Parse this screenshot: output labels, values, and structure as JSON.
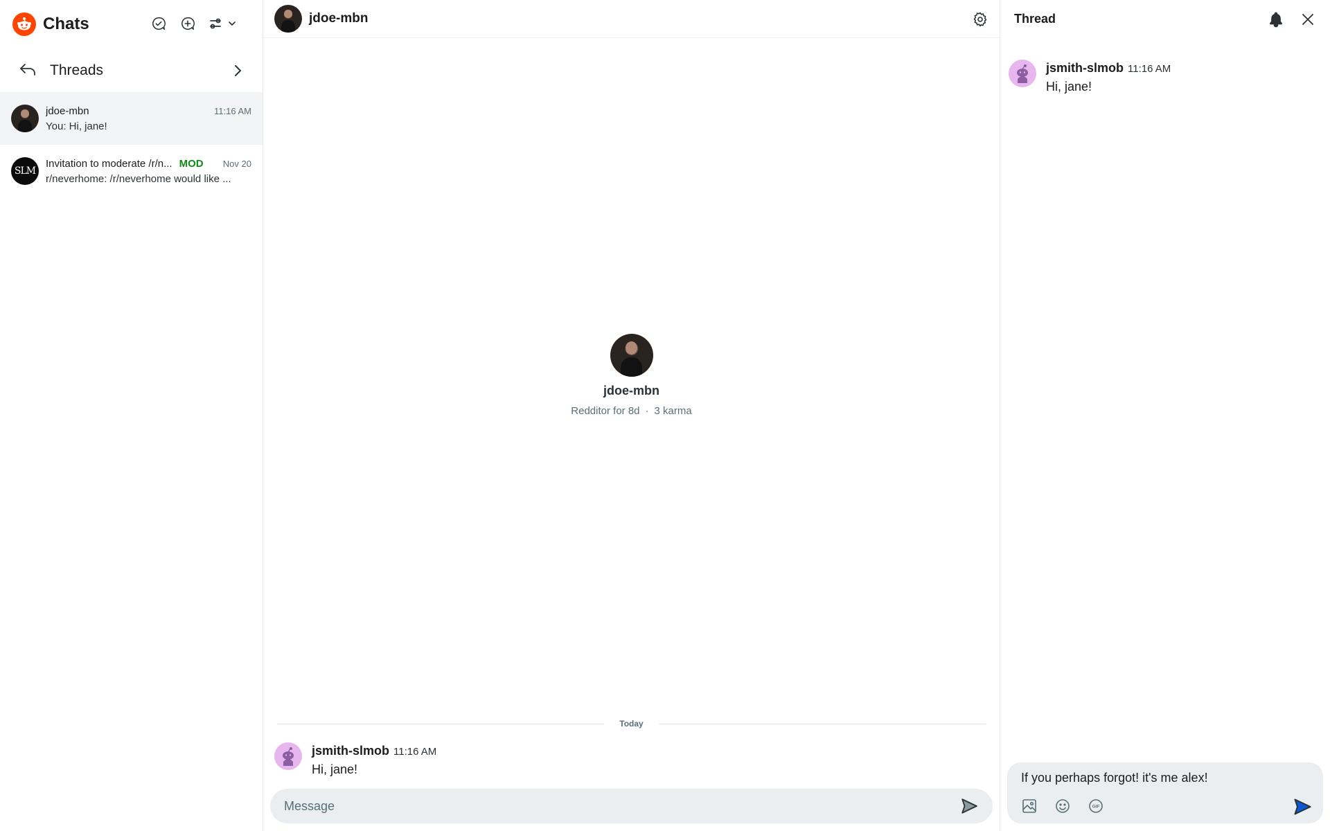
{
  "app": {
    "title": "Chats"
  },
  "sidebar": {
    "threads_label": "Threads",
    "chats": [
      {
        "name": "jdoe-mbn",
        "time": "11:16 AM",
        "preview": "You: Hi, jane!",
        "active": true,
        "avatar": "photo"
      },
      {
        "name": "Invitation to moderate /r/n...",
        "badge": "MOD",
        "time": "Nov 20",
        "preview": "r/neverhome: /r/neverhome would like ...",
        "active": false,
        "avatar": "SLM"
      }
    ]
  },
  "conversation": {
    "title": "jdoe-mbn",
    "profile": {
      "name": "jdoe-mbn",
      "age": "Redditor for 8d",
      "separator": "·",
      "karma": "3 karma"
    },
    "divider_label": "Today",
    "messages": [
      {
        "author": "jsmith-slmob",
        "time": "11:16 AM",
        "text": "Hi, jane!"
      }
    ],
    "composer": {
      "placeholder": "Message"
    }
  },
  "thread": {
    "title": "Thread",
    "messages": [
      {
        "author": "jsmith-slmob",
        "time": "11:16 AM",
        "text": "Hi, jane!"
      }
    ],
    "composer": {
      "draft": "If you perhaps forgot! it's me alex!"
    }
  },
  "colors": {
    "brand": "#ff4500",
    "mod_badge": "#0e8a16",
    "send_active": "#0a5ad8",
    "composer_bg": "#eaeef0",
    "snoo_avatar": "#e8b6ef"
  },
  "icons": {
    "logo": "reddit-logo-icon",
    "mark_read": "check-bubble-icon",
    "new_chat": "plus-bubble-icon",
    "filter": "sliders-icon",
    "back": "back-arrow-icon",
    "chevron": "chevron-right-icon",
    "settings": "gear-icon",
    "notifications": "bell-icon",
    "close": "close-icon",
    "image": "image-icon",
    "emoji": "emoji-icon",
    "gif": "gif-icon",
    "send": "send-icon"
  }
}
